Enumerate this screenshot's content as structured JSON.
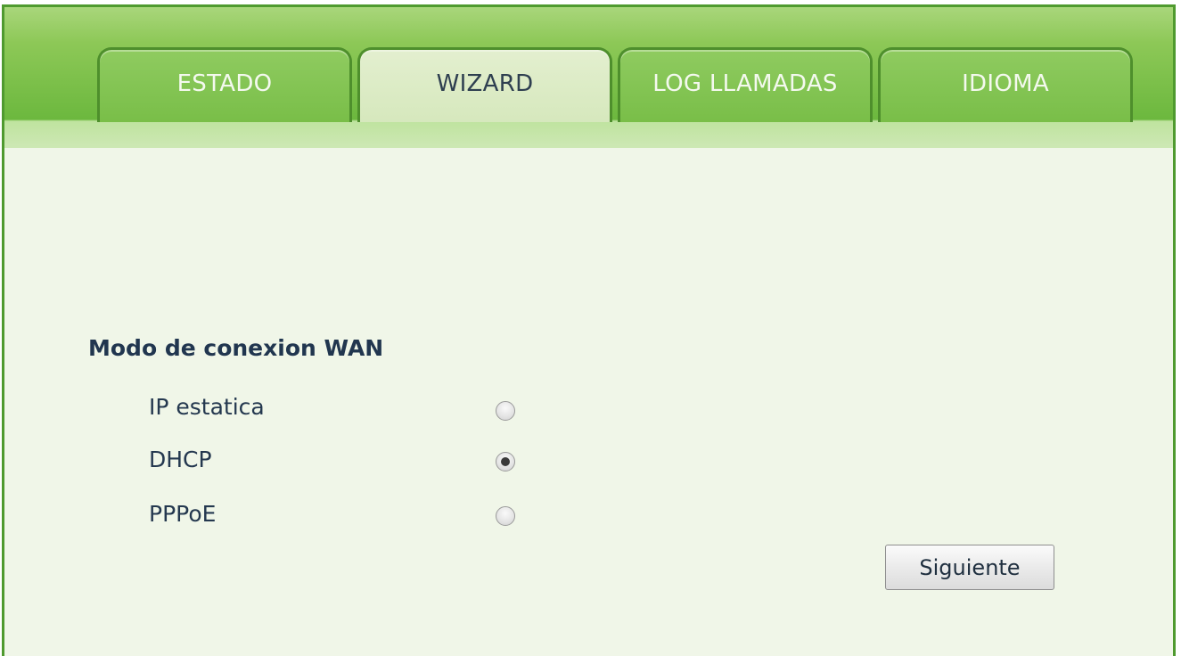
{
  "tabs": [
    {
      "label": "ESTADO",
      "active": false
    },
    {
      "label": "WIZARD",
      "active": true
    },
    {
      "label": "LOG LLAMADAS",
      "active": false
    },
    {
      "label": "IDIOMA",
      "active": false
    }
  ],
  "wan": {
    "title": "Modo de conexion WAN",
    "options": [
      {
        "label": "IP estatica",
        "selected": false
      },
      {
        "label": "DHCP",
        "selected": true
      },
      {
        "label": "PPPoE",
        "selected": false
      }
    ]
  },
  "actions": {
    "next_label": "Siguiente"
  },
  "colors": {
    "frame_border": "#4f9a2f",
    "tab_green": "#79be48",
    "tab_active": "#d6e8bd",
    "content_bg": "#f0f6e8"
  }
}
